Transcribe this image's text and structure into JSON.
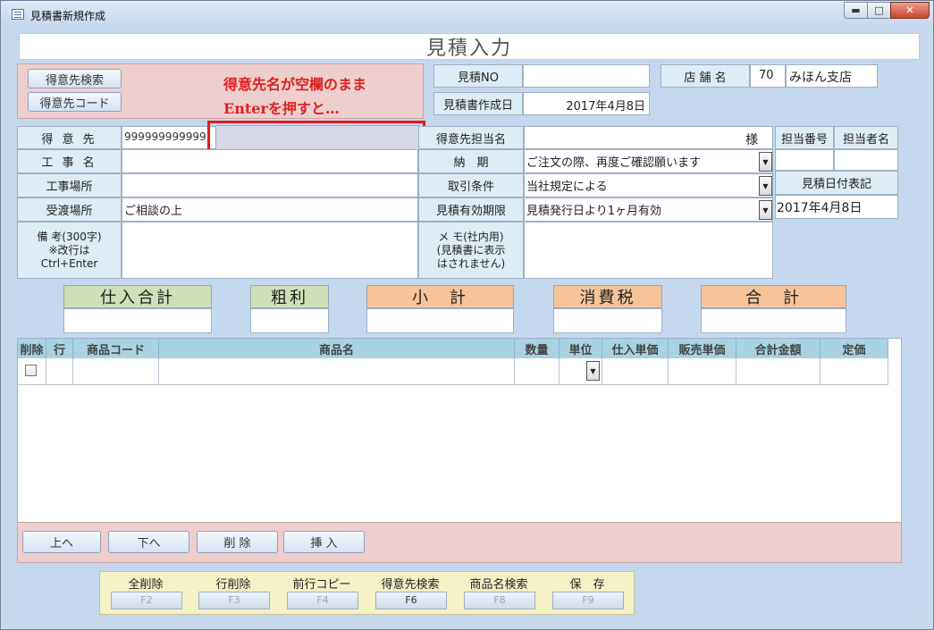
{
  "window": {
    "title": "見積書新規作成",
    "min": "▬",
    "max": "□",
    "close": "✕"
  },
  "header": {
    "title": "見積入力"
  },
  "panel": {
    "search_btn": "得意先検索",
    "code_btn": "得意先コード",
    "note_line1": "得意先名が空欄のまま",
    "note_line2": "Enterを押すと…"
  },
  "meta": {
    "quote_no_label": "見積NO",
    "quote_no": "",
    "shop_label": "店 舗 名",
    "shop_code": "70",
    "shop_name": "みほん支店",
    "date_label": "見積書作成日",
    "date_value": "2017年4月8日"
  },
  "form": {
    "customer_label": "得 意 先",
    "customer_code": "999999999999",
    "customer_name": "",
    "contact_label": "得意先担当名",
    "contact_suffix": "様",
    "staff_no_label": "担当番号",
    "staff_name_label": "担当者名",
    "work_name_label": "工 事 名",
    "delivery_label": "納　期",
    "delivery_value": "ご注文の際、再度ご確認願います",
    "site_label": "工事場所",
    "terms_label": "取引条件",
    "terms_value": "当社規定による",
    "date_note_label": "見積日付表記",
    "handover_label": "受渡場所",
    "handover_value": "ご相談の上",
    "validity_label": "見積有効期限",
    "validity_value": "見積発行日より1ヶ月有効",
    "date_note_value": "2017年4月8日",
    "remarks_label_1": "備 考(300字)",
    "remarks_label_2": "※改行は",
    "remarks_label_3": "Ctrl+Enter",
    "memo_label_1": "メ モ(社内用)",
    "memo_label_2": "(見積書に表示",
    "memo_label_3": "はされません)"
  },
  "totals": {
    "purchase": "仕入合計",
    "profit": "粗利",
    "subtotal": "小　計",
    "tax": "消費税",
    "total": "合　計"
  },
  "grid": {
    "columns": [
      "削除",
      "行",
      "商品コード",
      "商品名",
      "数量",
      "単位",
      "仕入単価",
      "販売単価",
      "合計金額",
      "定価"
    ]
  },
  "grid_buttons": {
    "up": "上へ",
    "down": "下へ",
    "delete": "削 除",
    "insert": "挿 入"
  },
  "fkeys": [
    {
      "label": "全削除",
      "key": "F2"
    },
    {
      "label": "行削除",
      "key": "F3"
    },
    {
      "label": "前行コピー",
      "key": "F4"
    },
    {
      "label": "得意先検索",
      "key": "F6"
    },
    {
      "label": "商品名検索",
      "key": "F8"
    },
    {
      "label": "保　存",
      "key": "F9"
    }
  ],
  "colors": {
    "pink_panel": "#efcece",
    "annotation_red": "#e02020",
    "header_blue": "#a9d3e3"
  }
}
